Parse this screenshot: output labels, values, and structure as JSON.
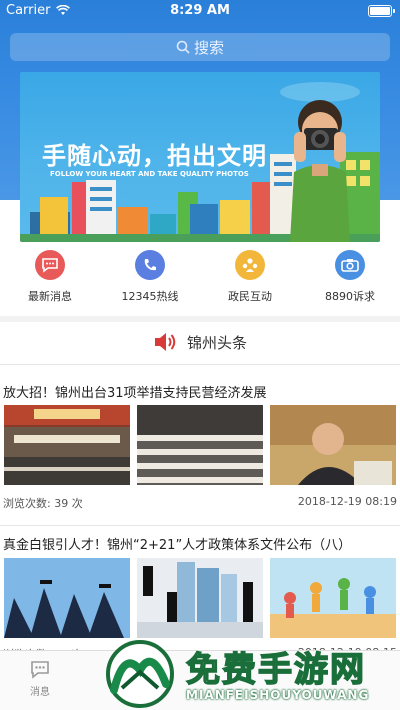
{
  "status_bar": {
    "carrier": "Carrier",
    "time": "8:29 AM"
  },
  "search": {
    "placeholder": "搜索"
  },
  "banner": {
    "title": "手随心动，拍出文明",
    "subtitle": "FOLLOW YOUR HEART AND TAKE QUALITY PHOTOS"
  },
  "quick_actions": [
    {
      "label": "最新消息",
      "icon": "chat-bubble-icon",
      "color": "#e85a5a"
    },
    {
      "label": "12345热线",
      "icon": "phone-icon",
      "color": "#5b7fe0"
    },
    {
      "label": "政民互动",
      "icon": "people-icon",
      "color": "#f2b73a"
    },
    {
      "label": "8890诉求",
      "icon": "camera-icon",
      "color": "#4a90e2"
    }
  ],
  "section": {
    "title": "锦州头条",
    "icon": "speaker-icon",
    "icon_color": "#d83a3a"
  },
  "news": [
    {
      "title": "放大招！锦州出台31项举措支持民营经济发展",
      "views_label": "浏览次数: 39  次",
      "date": "2018-12-19 08:19"
    },
    {
      "title": "真金白银引人才！锦州“2+21”人才政策体系文件公布（八）",
      "views_label": "浏览次数: 63  次",
      "date": "2018-12-19 08:15"
    }
  ],
  "tabbar": {
    "tab1": "消息"
  },
  "watermark": {
    "title": "免费手游网",
    "subtitle": "MIANFEISHOUYOUWANG"
  }
}
